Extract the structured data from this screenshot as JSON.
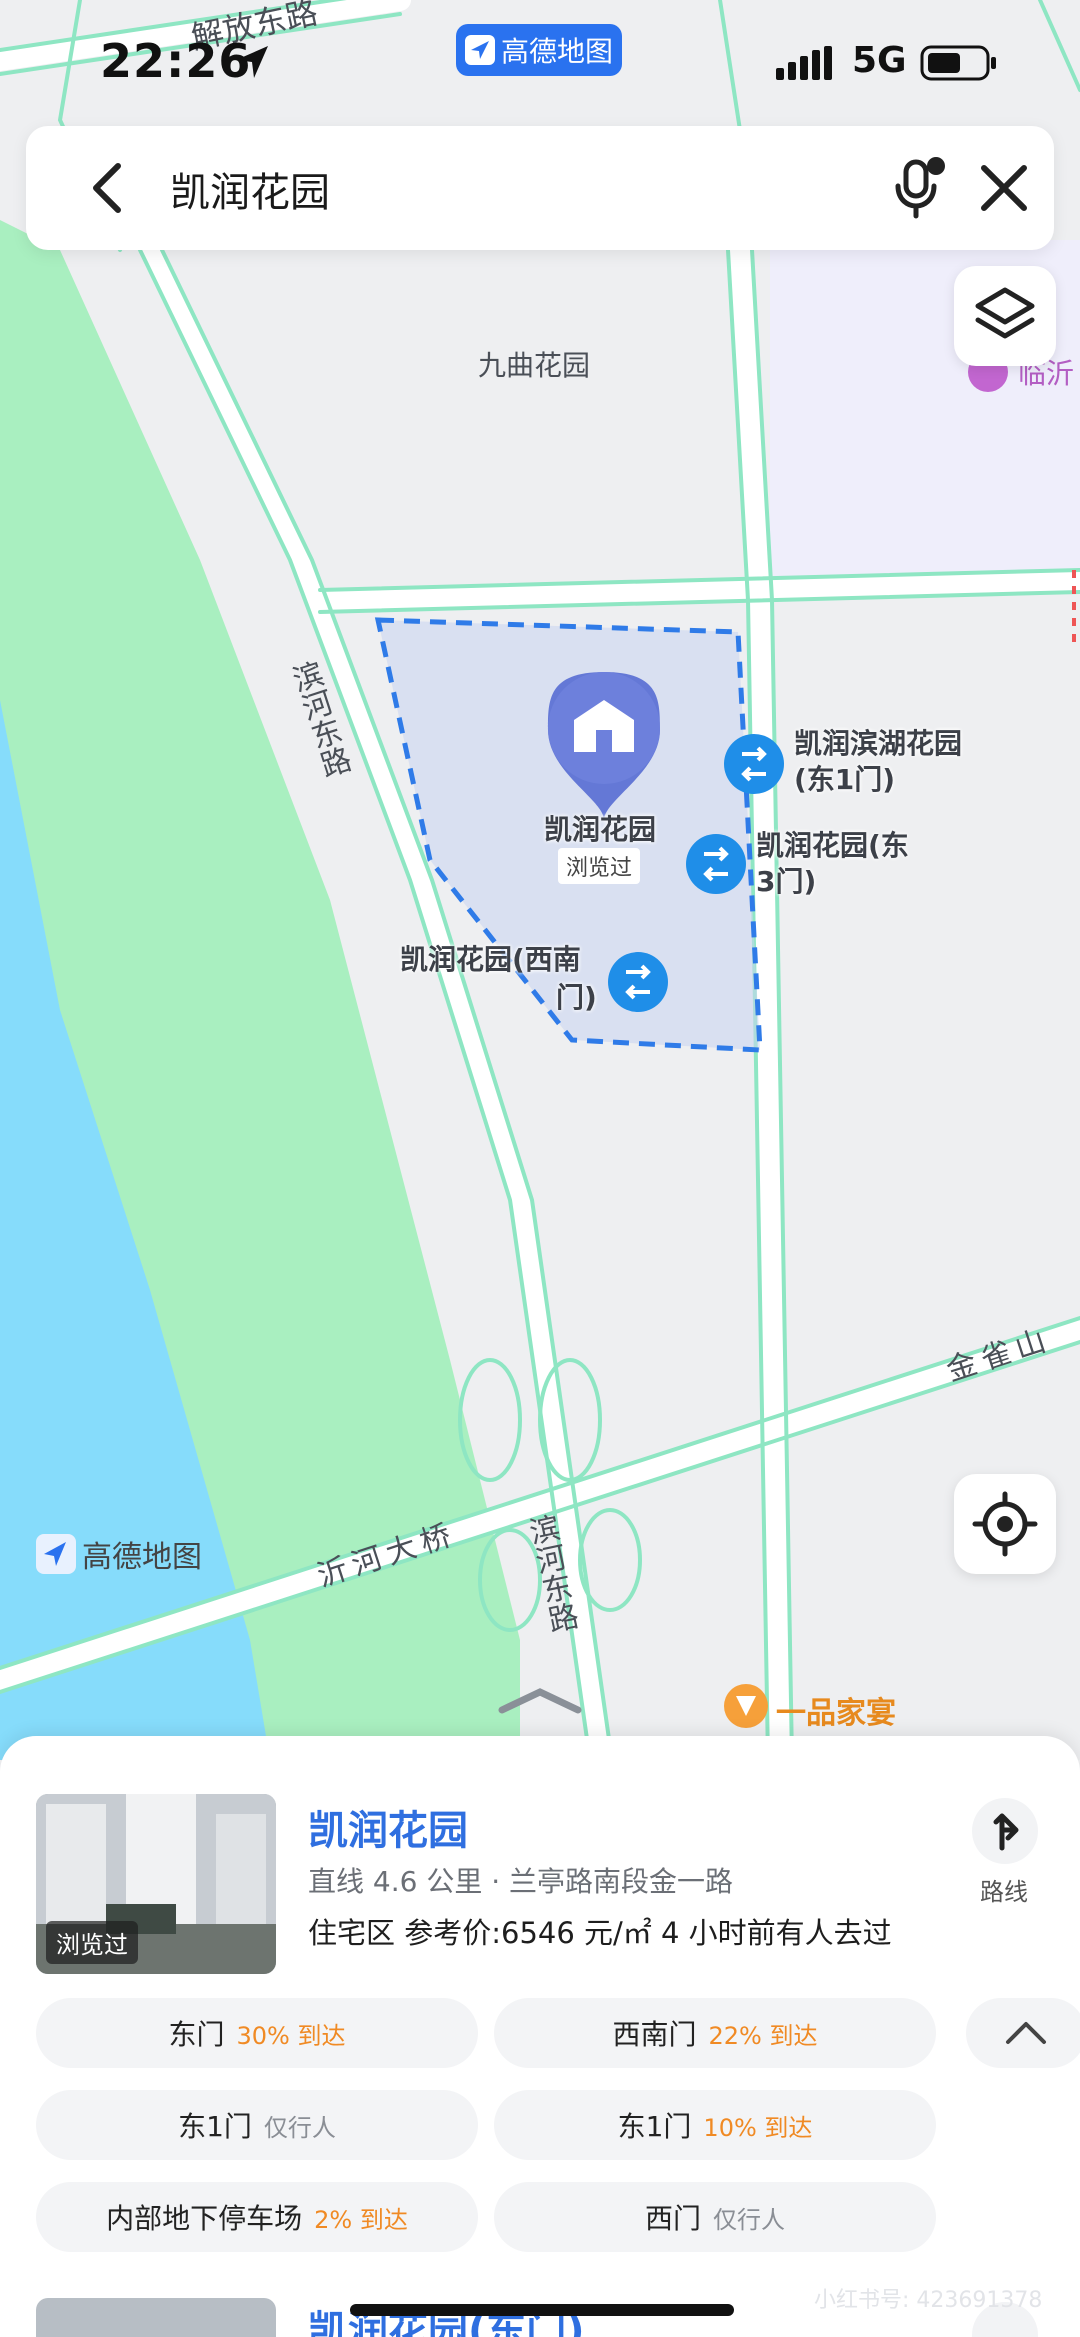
{
  "status_bar": {
    "time": "22:26",
    "app_badge": "高德地图",
    "network": "5G"
  },
  "search": {
    "query": "凯润花园"
  },
  "map": {
    "labels": {
      "road_top": "解放东路",
      "jiuqu": "九曲花园",
      "linyi": "临沂",
      "binhe_upper": "滨河东路",
      "binhe_lower": "滨河东路",
      "yihe_bridge": "沂河大桥",
      "jinque": "金雀山",
      "restaurant": "一品家宴"
    },
    "pois": {
      "main_name": "凯润花园",
      "main_tag": "浏览过",
      "east1_line1": "凯润滨湖花园",
      "east1_line2": "(东1门)",
      "east3_line1": "凯润花园(东",
      "east3_line2": "3门)",
      "southwest_line1": "凯润花园(西南",
      "southwest_line2": "门)"
    },
    "logo_text": "高德地图"
  },
  "result": {
    "title": "凯润花园",
    "meta": "直线 4.6 公里 · 兰亭路南段金一路",
    "info": "住宅区  参考价:6546 元/㎡  4 小时前有人去过",
    "thumb_tag": "浏览过",
    "route_label": "路线",
    "entrances": [
      {
        "name": "东门",
        "pct": "30% 到达",
        "note": ""
      },
      {
        "name": "西南门",
        "pct": "22% 到达",
        "note": ""
      },
      {
        "name": "东1门",
        "pct": "",
        "note": "仅行人"
      },
      {
        "name": "东1门",
        "pct": "10% 到达",
        "note": ""
      },
      {
        "name": "内部地下停车场",
        "pct": "2% 到达",
        "note": ""
      },
      {
        "name": "西门",
        "pct": "",
        "note": "仅行人"
      }
    ]
  },
  "next_result": {
    "title": "凯润花园(东门)"
  },
  "watermark": "小红书号: 423691378",
  "colors": {
    "brand_blue": "#2f6fe0",
    "orange": "#f08a24",
    "road_green": "#8ee6c3",
    "river": "#82d8fb"
  }
}
